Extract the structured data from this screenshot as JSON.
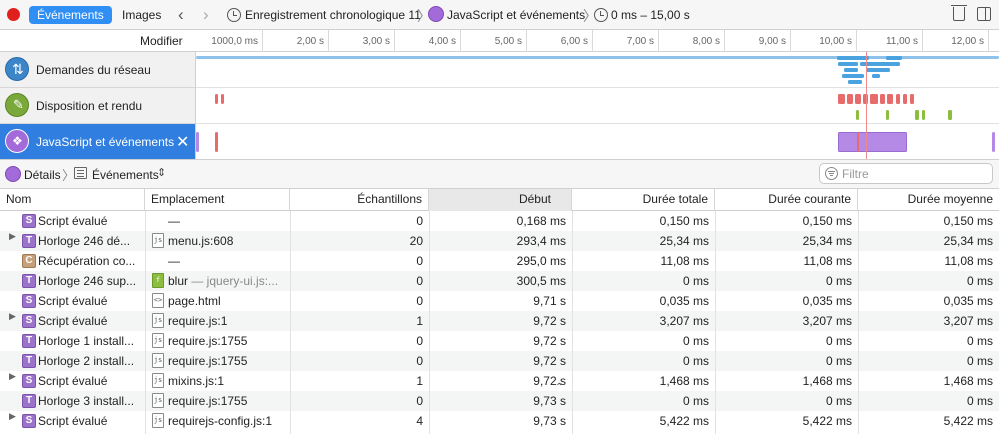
{
  "toolbar": {
    "tab_events": "Événements",
    "tab_images": "Images",
    "recording": "Enregistrement chronologique 11",
    "timeline": "JavaScript et événements",
    "range": "0 ms – 15,00 s"
  },
  "ruler": {
    "modify": "Modifier",
    "ticks": [
      "1000,0 ms",
      "2,00 s",
      "3,00 s",
      "4,00 s",
      "5,00 s",
      "6,00 s",
      "7,00 s",
      "8,00 s",
      "9,00 s",
      "10,00 s",
      "11,00 s",
      "12,00 s"
    ]
  },
  "overview": {
    "network": "Demandes du réseau",
    "layout": "Disposition et rendu",
    "js": "JavaScript et événements"
  },
  "details": {
    "crumb1": "Détails",
    "crumb2": "Événements",
    "filter_placeholder": "Filtre"
  },
  "table": {
    "headers": [
      "Nom",
      "Emplacement",
      "Échantillons",
      "Début",
      "Durée totale",
      "Durée courante",
      "Durée moyenne"
    ],
    "rows": [
      {
        "icon": "S",
        "name": "Script évalué",
        "loc": "—",
        "samples": "0",
        "start": "0,168 ms",
        "total": "0,150 ms",
        "self": "0,150 ms",
        "avg": "0,150 ms"
      },
      {
        "icon": "T",
        "name": "Horloge 246 dé...",
        "loc": "menu.js:608",
        "samples": "20",
        "start": "293,4 ms",
        "total": "25,34 ms",
        "self": "25,34 ms",
        "avg": "25,34 ms"
      },
      {
        "icon": "C",
        "name": "Récupération co...",
        "loc": "—",
        "samples": "0",
        "start": "295,0 ms",
        "total": "11,08 ms",
        "self": "11,08 ms",
        "avg": "11,08 ms"
      },
      {
        "icon": "T",
        "name": "Horloge 246 sup...",
        "loc": "blur",
        "loc2": " — jquery-ui.js:...",
        "samples": "0",
        "start": "300,5 ms",
        "total": "0 ms",
        "self": "0 ms",
        "avg": "0 ms"
      },
      {
        "icon": "S",
        "name": "Script évalué",
        "loc": "page.html",
        "samples": "0",
        "start": "9,71 s",
        "total": "0,035 ms",
        "self": "0,035 ms",
        "avg": "0,035 ms"
      },
      {
        "icon": "S",
        "name": "Script évalué",
        "loc": "require.js:1",
        "samples": "1",
        "start": "9,72 s",
        "total": "3,207 ms",
        "self": "3,207 ms",
        "avg": "3,207 ms"
      },
      {
        "icon": "T",
        "name": "Horloge 1 install...",
        "loc": "require.js:1755",
        "samples": "0",
        "start": "9,72 s",
        "total": "0 ms",
        "self": "0 ms",
        "avg": "0 ms"
      },
      {
        "icon": "T",
        "name": "Horloge 2 install...",
        "loc": "require.js:1755",
        "samples": "0",
        "start": "9,72 s",
        "total": "0 ms",
        "self": "0 ms",
        "avg": "0 ms"
      },
      {
        "icon": "S",
        "name": "Script évalué",
        "loc": "mixins.js:1",
        "samples": "1",
        "start": "9,72 s",
        "total": "1,468 ms",
        "self": "1,468 ms",
        "avg": "1,468 ms"
      },
      {
        "icon": "T",
        "name": "Horloge 3 install...",
        "loc": "require.js:1755",
        "samples": "0",
        "start": "9,73 s",
        "total": "0 ms",
        "self": "0 ms",
        "avg": "0 ms"
      },
      {
        "icon": "S",
        "name": "Script évalué",
        "loc": "requirejs-config.js:1",
        "samples": "4",
        "start": "9,73 s",
        "total": "5,422 ms",
        "self": "5,422 ms",
        "avg": "5,422 ms"
      }
    ]
  },
  "colors": {
    "accent": "#2f8ff5",
    "script": "#a36bd9",
    "timer": "#a36bd9",
    "network": "#4aa3df",
    "layout": "#e86b6b",
    "paint": "#8cbd3f"
  }
}
